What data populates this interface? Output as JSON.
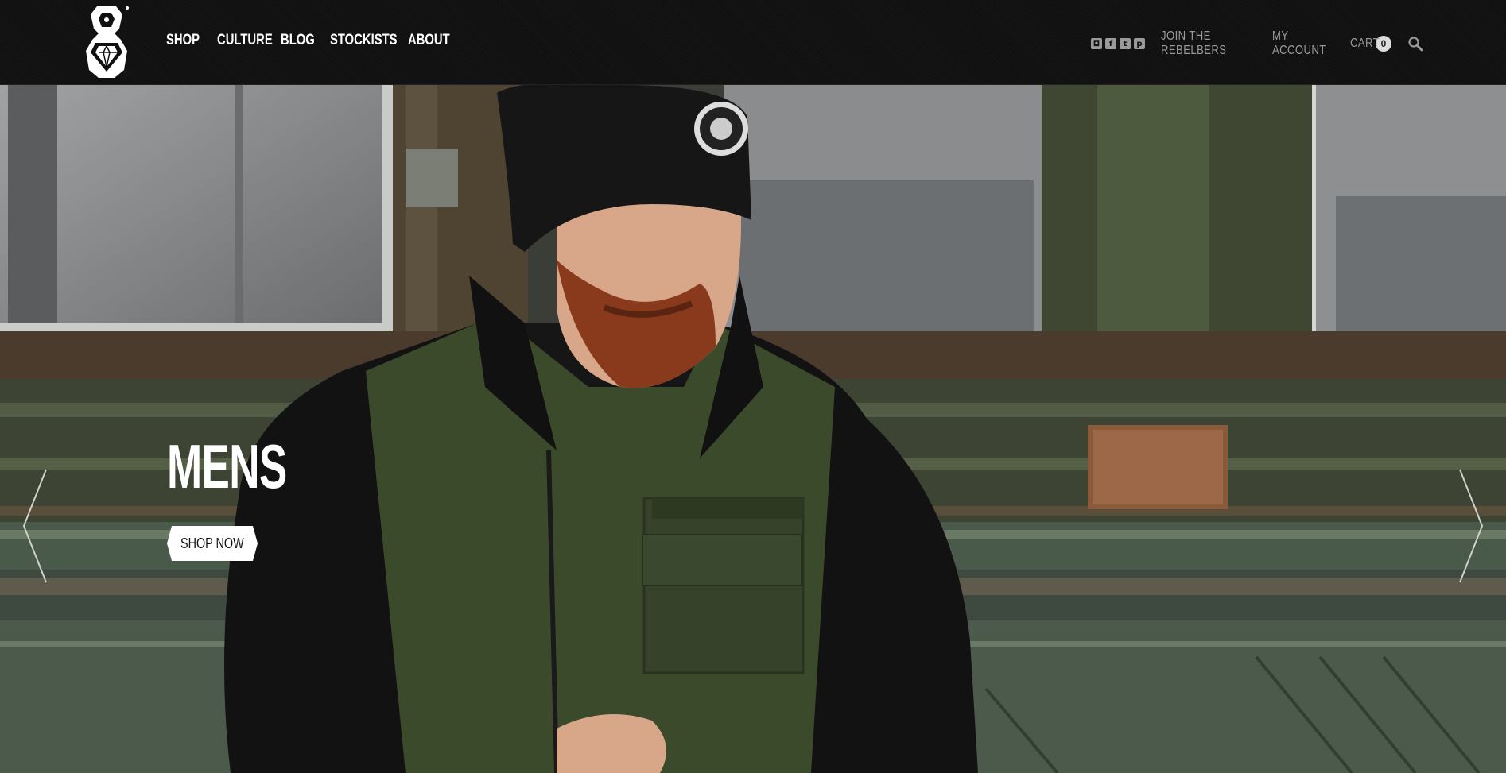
{
  "brand": {
    "logo_name": "rebel8-logo"
  },
  "nav": {
    "items": [
      {
        "label": "SHOP"
      },
      {
        "label": "CULTURE"
      },
      {
        "label": "BLOG"
      },
      {
        "label": "STOCKISTS"
      },
      {
        "label": "ABOUT"
      }
    ]
  },
  "utility": {
    "social_icons": [
      "instagram-icon",
      "facebook-icon",
      "twitter-icon",
      "pinterest-icon"
    ],
    "join_label": "JOIN THE REBELBERS",
    "account_label": "MY ACCOUNT",
    "cart_label": "CART",
    "cart_count": "0"
  },
  "hero": {
    "title": "MENS",
    "cta_label": "SHOP NOW"
  },
  "colors": {
    "header_bg": "#101010",
    "nav_text": "#ffffff",
    "utility_text": "#9a9a9a",
    "jacket_green": "#3c4a2c"
  }
}
